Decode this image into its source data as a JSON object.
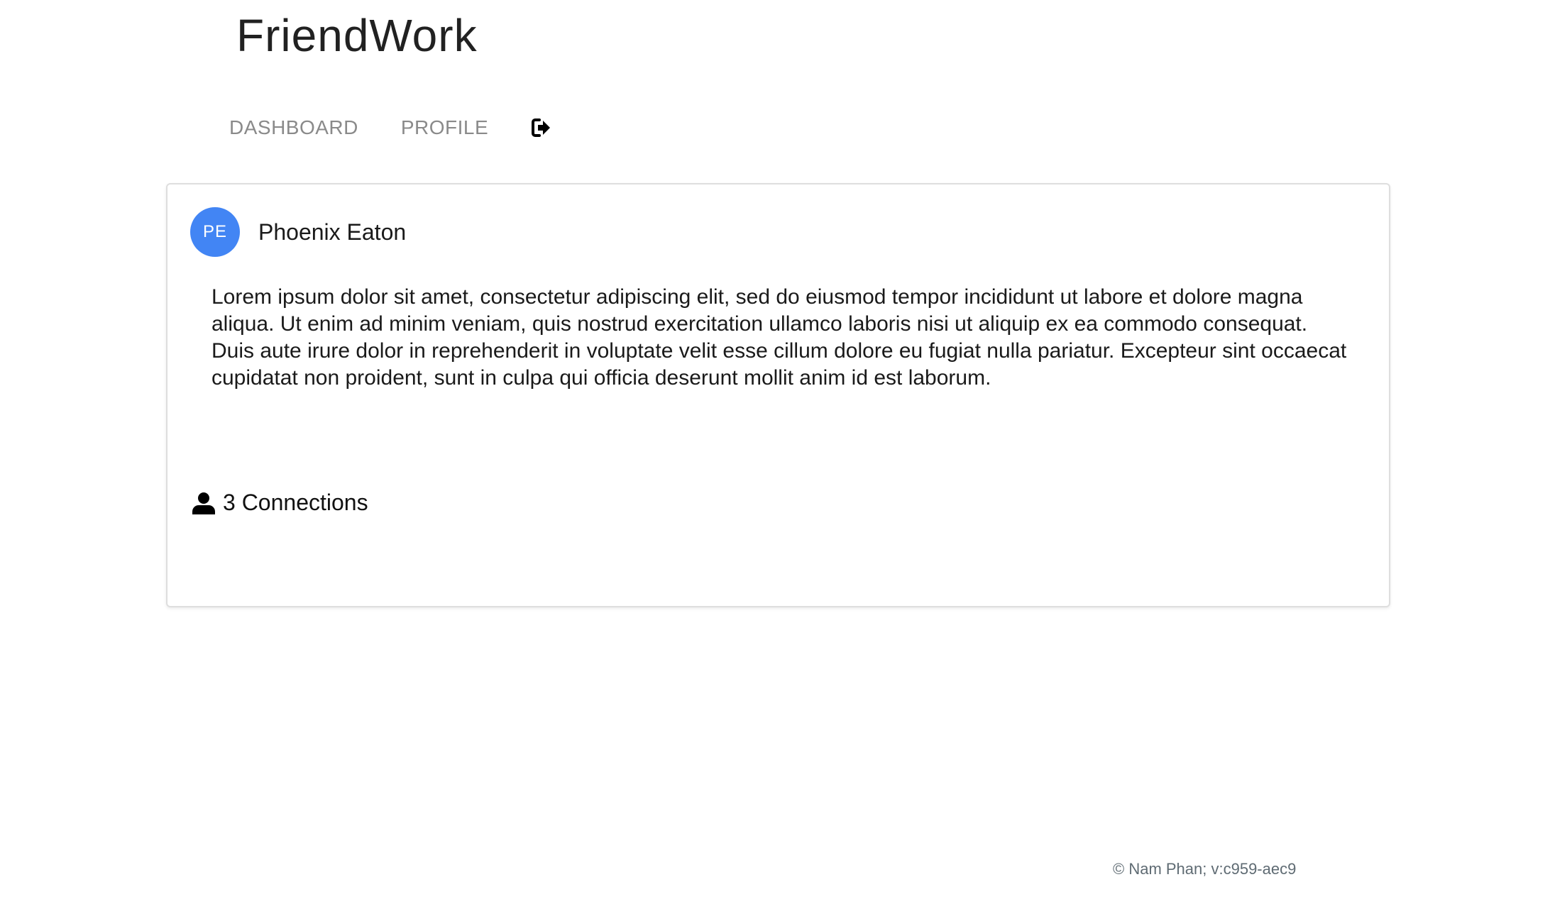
{
  "app": {
    "title": "FriendWork"
  },
  "nav": {
    "items": [
      {
        "label": "DASHBOARD"
      },
      {
        "label": "PROFILE"
      }
    ],
    "logout_icon": "sign-out-icon"
  },
  "profile": {
    "initials": "PE",
    "avatar_color": "#4285f4",
    "name": "Phoenix Eaton",
    "bio": "Lorem ipsum dolor sit amet, consectetur adipiscing elit, sed do eiusmod tempor incididunt ut labore et dolore magna aliqua. Ut enim ad minim veniam, quis nostrud exercitation ullamco laboris nisi ut aliquip ex ea commodo consequat. Duis aute irure dolor in reprehenderit in voluptate velit esse cillum dolore eu fugiat nulla pariatur. Excepteur sint occaecat cupidatat non proident, sunt in culpa qui officia deserunt mollit anim id est laborum.",
    "connections_icon": "user-icon",
    "connections_label": "3 Connections"
  },
  "footer": {
    "text": "© Nam Phan; v:c959-aec9"
  }
}
